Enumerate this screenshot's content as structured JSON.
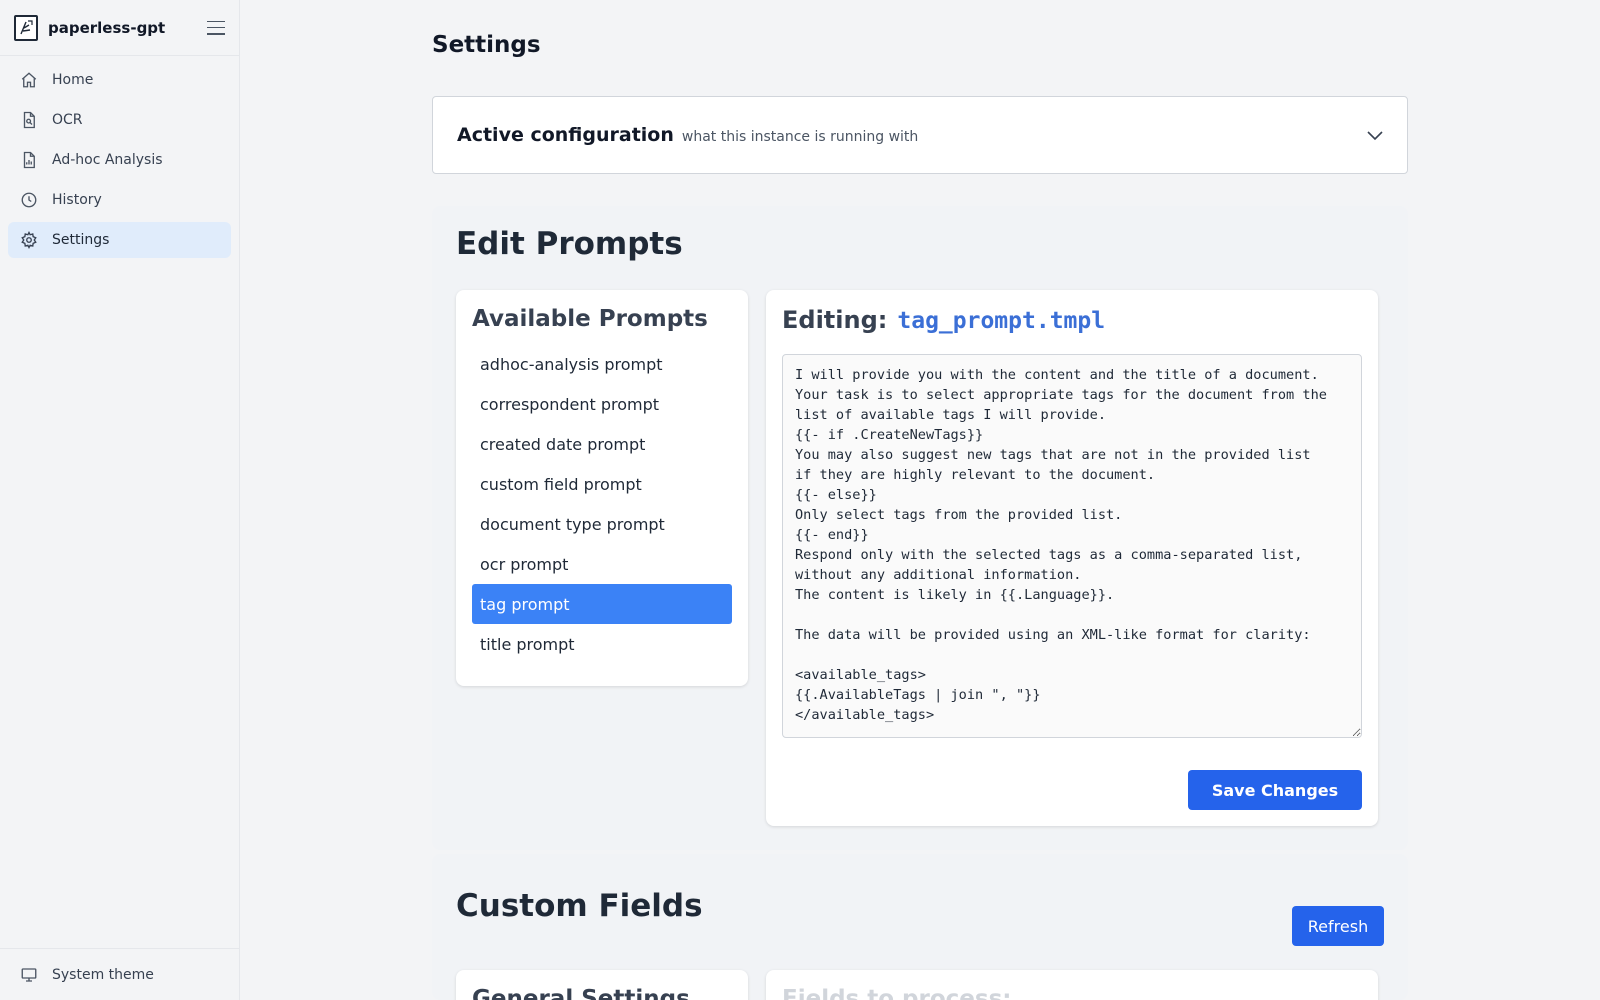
{
  "app": {
    "name": "paperless-gpt"
  },
  "sidebar": {
    "items": [
      {
        "label": "Home",
        "icon": "home-icon"
      },
      {
        "label": "OCR",
        "icon": "file-search-icon"
      },
      {
        "label": "Ad-hoc Analysis",
        "icon": "file-chart-icon"
      },
      {
        "label": "History",
        "icon": "clock-icon"
      },
      {
        "label": "Settings",
        "icon": "gear-icon",
        "active": true
      }
    ],
    "footer_label": "System theme"
  },
  "main": {
    "title": "Settings",
    "config": {
      "title": "Active configuration",
      "subtitle": "what this instance is running with"
    },
    "prompts_section": {
      "title": "Edit Prompts",
      "list_title": "Available Prompts",
      "items": [
        "adhoc-analysis prompt",
        "correspondent prompt",
        "created date prompt",
        "custom field prompt",
        "document type prompt",
        "ocr prompt",
        "tag prompt",
        "title prompt"
      ],
      "selected_index": 6,
      "editor": {
        "label": "Editing:",
        "filename": "tag_prompt.tmpl",
        "content": "I will provide you with the content and the title of a document.\nYour task is to select appropriate tags for the document from the\nlist of available tags I will provide.\n{{- if .CreateNewTags}}\nYou may also suggest new tags that are not in the provided list\nif they are highly relevant to the document.\n{{- else}}\nOnly select tags from the provided list.\n{{- end}}\nRespond only with the selected tags as a comma-separated list,\nwithout any additional information.\nThe content is likely in {{.Language}}.\n\nThe data will be provided using an XML-like format for clarity:\n\n<available_tags>\n{{.AvailableTags | join \", \"}}\n</available_tags>",
        "save_label": "Save Changes"
      }
    },
    "custom_fields": {
      "title": "Custom Fields",
      "refresh_label": "Refresh",
      "general_title": "General Settings",
      "fields_title": "Fields to process:"
    }
  },
  "colors": {
    "accent": "#2563eb",
    "selected": "#3b82f6",
    "active_nav": "#e0ecfb",
    "filename": "#3b6fd6"
  }
}
